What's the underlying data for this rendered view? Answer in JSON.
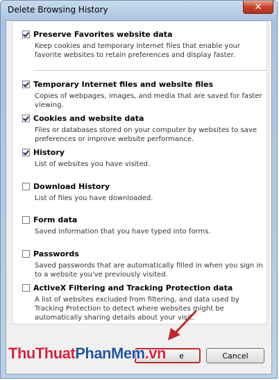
{
  "window": {
    "title": "Delete Browsing History",
    "close_glyph": "✕"
  },
  "options": [
    {
      "label": "Preserve Favorites website data",
      "checked": true,
      "description": "Keep cookies and temporary Internet files that enable your favorite websites to retain preferences and display faster."
    },
    {
      "label": "Temporary Internet files and website files",
      "checked": true,
      "description": "Copies of webpages, images, and media that are saved for faster viewing."
    },
    {
      "label": "Cookies and website data",
      "checked": true,
      "description": "Files or databases stored on your computer by websites to save preferences or improve website performance."
    },
    {
      "label": "History",
      "checked": true,
      "description": "List of websites you have visited."
    },
    {
      "label": "Download History",
      "checked": false,
      "description": "List of files you have downloaded."
    },
    {
      "label": "Form data",
      "checked": false,
      "description": "Saved information that you have typed into forms."
    },
    {
      "label": "Passwords",
      "checked": false,
      "description": "Saved passwords that are automatically filled in when you sign in to a website you've previously visited."
    },
    {
      "label": "ActiveX Filtering and Tracking Protection data",
      "checked": false,
      "description": "A list of websites excluded from filtering, and data used by Tracking Protection to detect where websites might be automatically sharing details about your visit."
    }
  ],
  "buttons": {
    "delete_label": "e",
    "cancel_label": "Cancel"
  },
  "watermark": {
    "part1": "ThuThuat",
    "part2": "PhanMem",
    "part3": ".vn"
  },
  "colors": {
    "accent_arrow": "#c0282a",
    "watermark_red": "#d8203a",
    "watermark_blue": "#1e55a8"
  }
}
